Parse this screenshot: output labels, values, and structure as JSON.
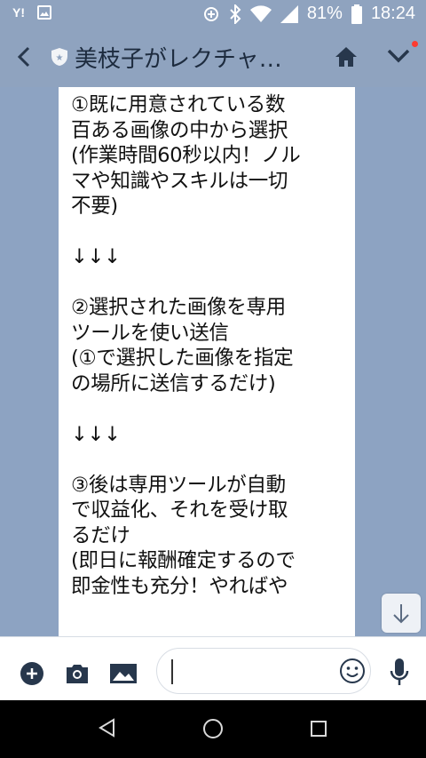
{
  "status_bar": {
    "battery": "81%",
    "time": "18:24",
    "carrier_icon": "Y!"
  },
  "header": {
    "title": "美枝子がレクチャ…"
  },
  "message": {
    "text": "①既に用意されている数\n百ある画像の中から選択\n(作業時間60秒以内！ノル\nマや知識やスキルは一切\n不要)\n\n↓↓↓\n\n②選択された画像を専用\nツールを使い送信\n(①で選択した画像を指定\nの場所に送信するだけ)\n\n↓↓↓\n\n③後は専用ツールが自動\nで収益化、それを受け取\nるだけ\n(即日に報酬確定するので\n即金性も充分！やればや"
  },
  "colors": {
    "header_bg": "#8fa3bf",
    "chat_bg": "#8da3c2",
    "bubble_bg": "#ffffff",
    "icon_dark": "#27374c",
    "notification_dot": "#ff3b30"
  },
  "icons": {
    "status_left": [
      "yahoo-icon",
      "image-icon"
    ],
    "status_right": [
      "data-saver-icon",
      "bluetooth-icon",
      "wifi-icon",
      "signal-icon",
      "battery-icon"
    ],
    "header": [
      "back-icon",
      "shield-icon",
      "home-icon",
      "chevron-down-icon"
    ],
    "input": [
      "plus-icon",
      "camera-icon",
      "image-icon",
      "emoji-icon",
      "mic-icon"
    ],
    "nav": [
      "nav-back-icon",
      "nav-home-icon",
      "nav-recent-icon"
    ]
  }
}
